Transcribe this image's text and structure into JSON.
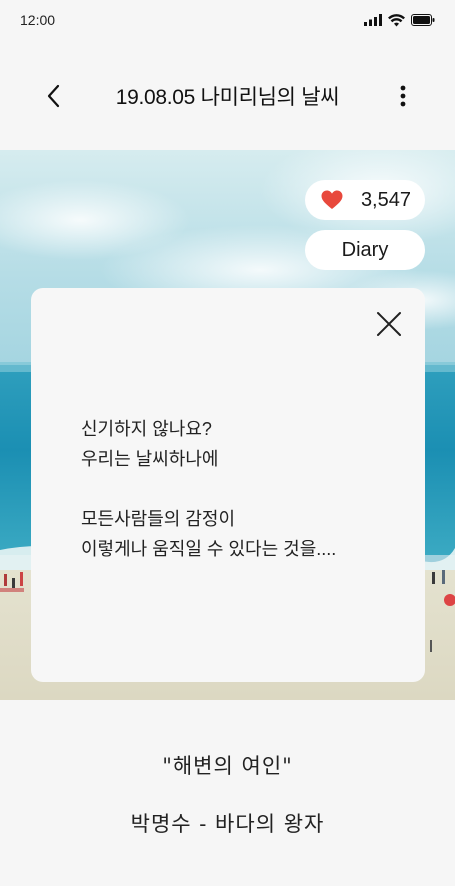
{
  "status_bar": {
    "time": "12:00"
  },
  "header": {
    "title": "19.08.05 나미리님의 날씨"
  },
  "hero": {
    "likes": "3,547",
    "diary_label": "Diary",
    "like_color": "#e8483c"
  },
  "note": {
    "text": "신기하지 않나요?\n우리는 날씨하나에\n\n모든사람들의 감정이\n이렇게나 움직일 수 있다는 것을...."
  },
  "caption": {
    "title": "\"해변의 여인\"",
    "subtitle": "박명수 - 바다의 왕자"
  }
}
